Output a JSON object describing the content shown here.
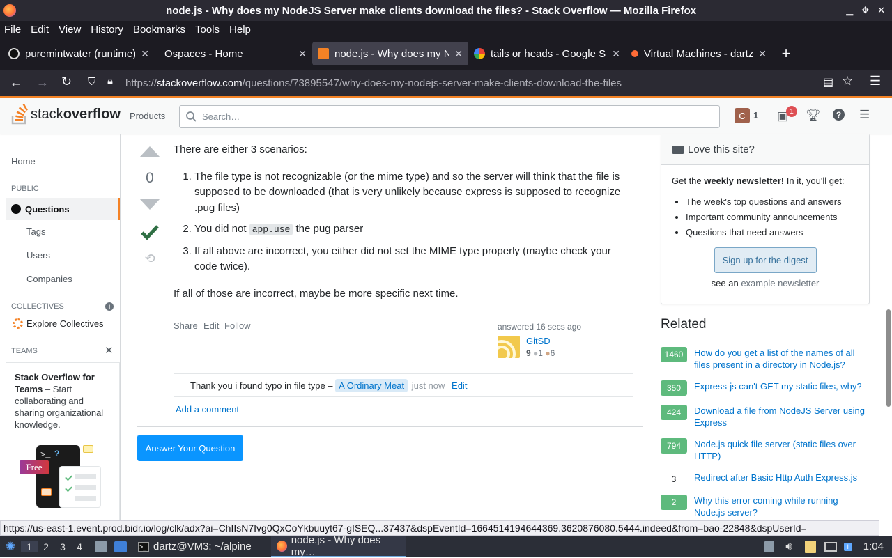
{
  "window": {
    "title": "node.js - Why does my NodeJS Server make clients download the files? - Stack Overflow — Mozilla Firefox"
  },
  "menubar": [
    "File",
    "Edit",
    "View",
    "History",
    "Bookmarks",
    "Tools",
    "Help"
  ],
  "tabs": [
    {
      "label": "puremintwater (runtime)",
      "icon_color": "#1b1b1b"
    },
    {
      "label": "Ospaces - Home",
      "icon_color": "#2b2a33"
    },
    {
      "label": "node.js - Why does my N",
      "icon_color": "#f48225"
    },
    {
      "label": "tails or heads - Google Se",
      "icon_color": "#4285f4"
    },
    {
      "label": "Virtual Machines - dartz@",
      "icon_color": "#ff6c37"
    }
  ],
  "newtab_label": "+",
  "url": {
    "prefix": "https://",
    "host": "stackoverflow.com",
    "path": "/questions/73895547/why-does-my-nodejs-server-make-clients-download-the-files"
  },
  "so_header": {
    "logo_light": "stack",
    "logo_bold": "overflow",
    "products": "Products",
    "search_placeholder": "Search…",
    "user_initial": "C",
    "reputation": "1",
    "inbox_badge": "1"
  },
  "leftnav": {
    "home": "Home",
    "public": "PUBLIC",
    "questions": "Questions",
    "tags": "Tags",
    "users": "Users",
    "companies": "Companies",
    "collectives": "COLLECTIVES",
    "explore_collectives": "Explore Collectives",
    "teams": "TEAMS",
    "teams_title": "Stack Overflow for Teams",
    "teams_body": " – Start collaborating and sharing organizational knowledge.",
    "free_badge": "Free"
  },
  "answer": {
    "score": "0",
    "intro": "There are either 3 scenarios:",
    "items": [
      "The file type is not recognizable (or the mime type) and so the server will think that the file is supposed to be downloaded (that is very unlikely because express is supposed to recognize .pug files)",
      "the pug parser",
      "If all above are incorrect, you either did not set the MIME type properly (maybe check your code twice)."
    ],
    "item2_prefix": "You did not ",
    "item2_code": "app.use",
    "outro": "If all of those are incorrect, maybe be more specific next time.",
    "menu": {
      "share": "Share",
      "edit": "Edit",
      "follow": "Follow"
    },
    "answered": "answered 16 secs ago",
    "user_name": "GitSD",
    "user_rep": "9",
    "silver": "1",
    "bronze": "6"
  },
  "comment": {
    "text": "Thank you i found typo in file type –",
    "author": "A Ordinary Meat",
    "time": "just now",
    "edit": "Edit"
  },
  "add_comment": "Add a comment",
  "answer_button": "Answer Your Question",
  "newsletter": {
    "title": "Love this site?",
    "intro_pre": "Get the ",
    "intro_bold": "weekly newsletter!",
    "intro_post": " In it, you'll get:",
    "bullets": [
      "The week's top questions and answers",
      "Important community announcements",
      "Questions that need answers"
    ],
    "button": "Sign up for the digest",
    "see_pre": "see an ",
    "see_link": "example newsletter"
  },
  "related": {
    "heading": "Related",
    "items": [
      {
        "score": "1460",
        "title": "How do you get a list of the names of all files present in a directory in Node.js?"
      },
      {
        "score": "350",
        "title": "Express-js can't GET my static files, why?"
      },
      {
        "score": "424",
        "title": "Download a file from NodeJS Server using Express"
      },
      {
        "score": "794",
        "title": "Node.js quick file server (static files over HTTP)"
      },
      {
        "score": "3",
        "title": "Redirect after Basic Http Auth Express.js"
      },
      {
        "score": "2",
        "title": "Why this error coming while running Node.js server?"
      }
    ]
  },
  "status_link": "https://us-east-1.event.prod.bidr.io/log/clk/adx?ai=ChIIsN7Ivg0QxCoYkbuuyt67-gISEQ...37437&dspEventId=1664514194644369.3620876080.5444.indeed&from=bao-22848&dspUserId=",
  "taskbar": {
    "workspaces": [
      "1",
      "2",
      "3",
      "4"
    ],
    "terminal_task": "dartz@VM3: ~/alpine",
    "firefox_task": "node.js - Why does my…",
    "clock": "1:04"
  }
}
